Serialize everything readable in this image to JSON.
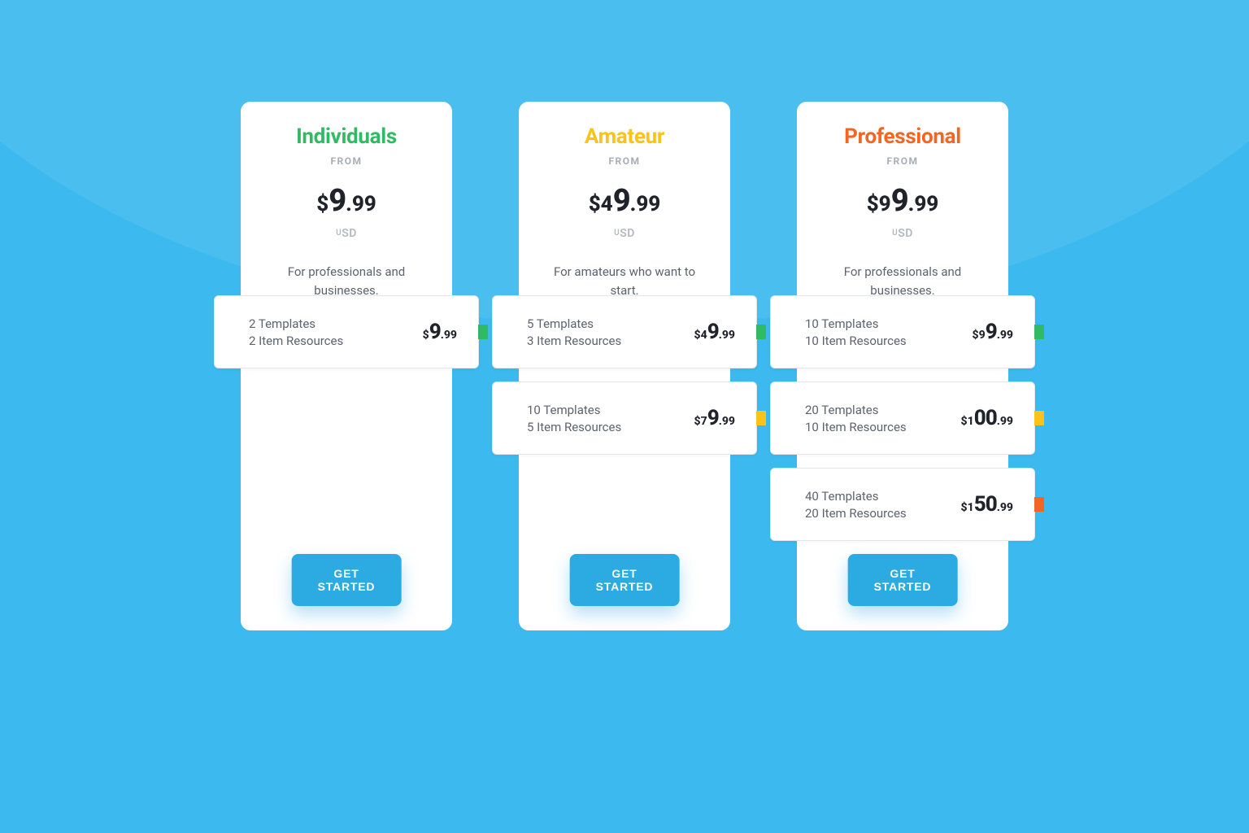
{
  "plans": [
    {
      "key": "individuals",
      "title": "Individuals",
      "from": "FROM",
      "priceDollar": "$",
      "priceBig": "9",
      "priceCents": ".99",
      "currency": "SD",
      "desc": "For professionals and businesses.",
      "cta": "GET STARTED",
      "tiers": [
        {
          "line1": "2 Templates",
          "line2": "2 Item Resources",
          "dollar": "$",
          "big": "9",
          "cents": ".99",
          "tab": "green"
        }
      ]
    },
    {
      "key": "amateur",
      "title": "Amateur",
      "from": "FROM",
      "priceDollar": "$4",
      "priceBig": "9",
      "priceCents": ".99",
      "currency": "SD",
      "desc": "For amateurs who want to start.",
      "cta": "GET STARTED",
      "tiers": [
        {
          "line1": "5 Templates",
          "line2": "3 Item Resources",
          "dollar": "$4",
          "big": "9",
          "cents": ".99",
          "tab": "green"
        },
        {
          "line1": "10 Templates",
          "line2": "5 Item Resources",
          "dollar": "$7",
          "big": "9",
          "cents": ".99",
          "tab": "yellow"
        }
      ]
    },
    {
      "key": "professional",
      "title": "Professional",
      "from": "FROM",
      "priceDollar": "$9",
      "priceBig": "9",
      "priceCents": ".99",
      "currency": "SD",
      "desc": "For professionals and businesses.",
      "cta": "GET STARTED",
      "tiers": [
        {
          "line1": "10 Templates",
          "line2": "10 Item Resources",
          "dollar": "$9",
          "big": "9",
          "cents": ".99",
          "tab": "green"
        },
        {
          "line1": "20 Templates",
          "line2": "10 Item Resources",
          "dollar": "$1",
          "big": "00",
          "cents": ".99",
          "tab": "yellow"
        },
        {
          "line1": "40 Templates",
          "line2": "20 Item Resources",
          "dollar": "$1",
          "big": "50",
          "cents": ".99",
          "tab": "orange"
        }
      ]
    }
  ]
}
